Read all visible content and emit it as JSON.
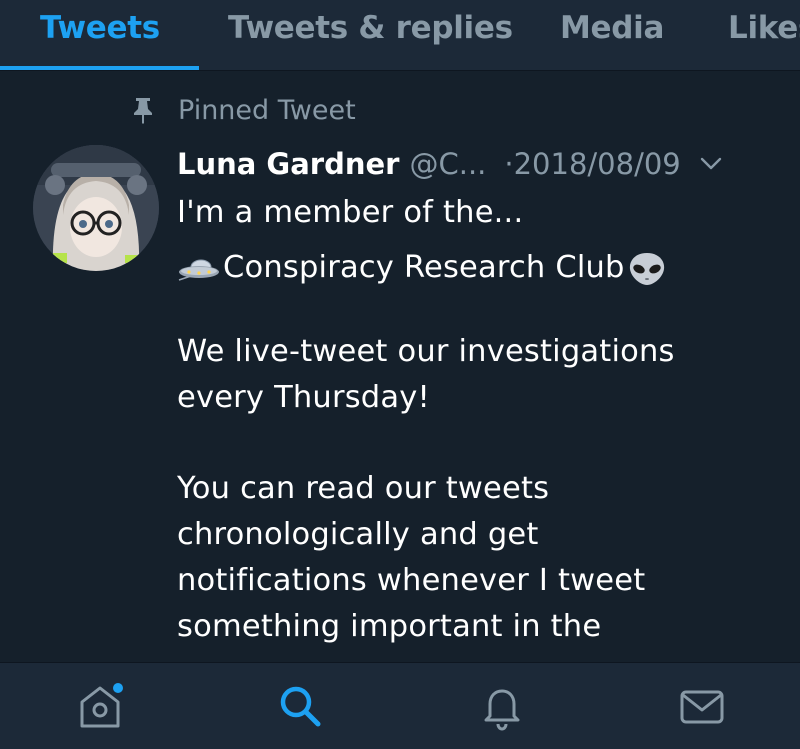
{
  "tabs": [
    {
      "label": "Tweets",
      "active": true
    },
    {
      "label": "Tweets & replies",
      "active": false
    },
    {
      "label": "Media",
      "active": false
    },
    {
      "label": "Likes",
      "active": false
    }
  ],
  "tweet": {
    "pinned_label": "Pinned Tweet",
    "author_name": "Luna Gardner",
    "author_handle": "@C...",
    "date": "·2018/08/09",
    "lines": [
      "I'm a member of the...",
      "Conspiracy Research Club",
      "We live-tweet our investigations",
      "every Thursday!",
      "You can read our tweets",
      "chronologically and get",
      "notifications whenever I tweet",
      "something important in the"
    ]
  },
  "icons": {
    "pin": "pin-icon",
    "caret": "chevron-down-icon",
    "ufo": "ufo-emoji",
    "alien": "alien-emoji",
    "home": "home-icon",
    "search": "search-icon",
    "notifications": "bell-icon",
    "messages": "mail-icon"
  },
  "colors": {
    "background": "#15202b",
    "bar": "#1c2938",
    "accent": "#1da1f2",
    "muted": "#8899a6"
  }
}
